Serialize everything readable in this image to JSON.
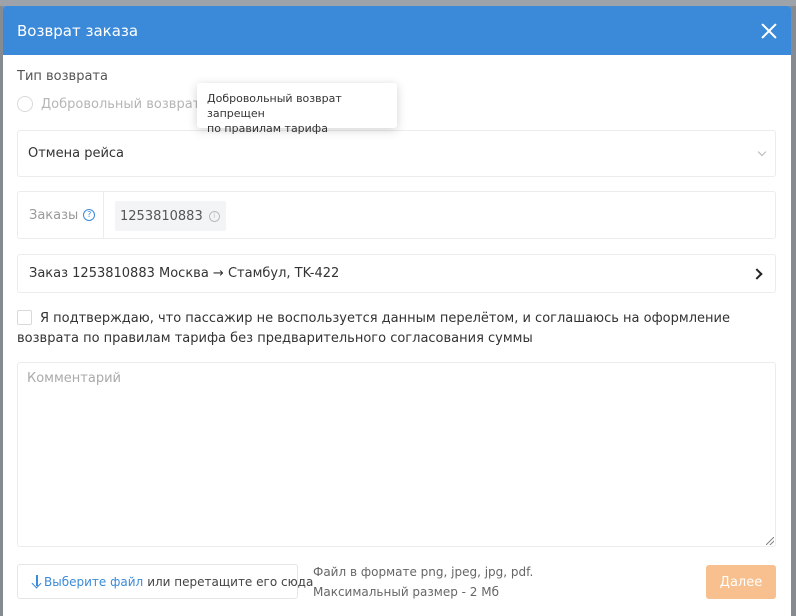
{
  "modal": {
    "title": "Возврат заказа"
  },
  "return_type": {
    "label": "Тип возврата",
    "voluntary_label": "Добровольный возврат",
    "tooltip_line1": "Добровольный возврат запрещен",
    "tooltip_line2": "по правилам тарифа"
  },
  "reason_select": {
    "value": "Отмена рейса"
  },
  "orders": {
    "label": "Заказы",
    "help_icon": "?",
    "order_number": "1253810883",
    "info_icon": "i"
  },
  "order_row": {
    "text": "Заказ 1253810883 Москва → Стамбул, TK-422"
  },
  "confirm": {
    "text": "Я подтверждаю, что пассажир не воспользуется данным перелётом, и соглашаюсь на оформление возврата по правилам тарифа без предварительного согласования суммы"
  },
  "comment": {
    "placeholder": "Комментарий"
  },
  "upload": {
    "link_text": "Выберите файл",
    "rest_text": "или перетащите его сюда",
    "hint_line1": "Файл в формате png, jpeg, jpg, pdf.",
    "hint_line2": "Максимальный размер - 2 Мб"
  },
  "actions": {
    "next_label": "Далее"
  },
  "colors": {
    "header": "#3b8ad9",
    "next_button_disabled": "#f7c08e",
    "link": "#3b8ad9"
  }
}
